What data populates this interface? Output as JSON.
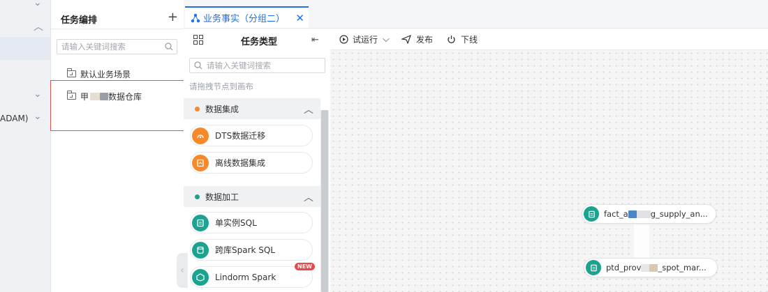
{
  "left_strip": {
    "partial_label": "ADAM)"
  },
  "task_panel": {
    "title": "任务编排",
    "search_placeholder": "请输入关键词搜索",
    "tree": [
      {
        "label": "默认业务场景"
      },
      {
        "label_prefix": "甲",
        "label_suffix": "数据仓库"
      }
    ]
  },
  "tab": {
    "label": "业务事实（分组二）"
  },
  "palette": {
    "title": "任务类型",
    "search_placeholder": "请输入关键词搜索",
    "hint": "请拖拽节点到画布",
    "groups": [
      {
        "label": "数据集成",
        "dot_color": "#f7892b",
        "items": [
          {
            "label": "DTS数据迁移",
            "color": "#f7892b"
          },
          {
            "label": "离线数据集成",
            "color": "#f7892b"
          }
        ]
      },
      {
        "label": "数据加工",
        "dot_color": "#1ba38f",
        "items": [
          {
            "label": "单实例SQL",
            "color": "#1ba38f"
          },
          {
            "label": "跨库Spark SQL",
            "color": "#1ba38f"
          },
          {
            "label": "Lindorm Spark",
            "color": "#1ba38f",
            "badge": "NEW"
          }
        ]
      }
    ]
  },
  "toolbar": {
    "test_run": "试运行",
    "publish": "发布",
    "offline": "下线"
  },
  "canvas": {
    "nodes": [
      {
        "prefix": "fact_a",
        "suffix": "g_supply_an..."
      },
      {
        "prefix": "ptd_prov",
        "suffix": "_spot_mar..."
      }
    ]
  },
  "colors": {
    "accent": "#1f6fe5",
    "alert_box": "#e05252",
    "new_badge": "#e5484d"
  }
}
